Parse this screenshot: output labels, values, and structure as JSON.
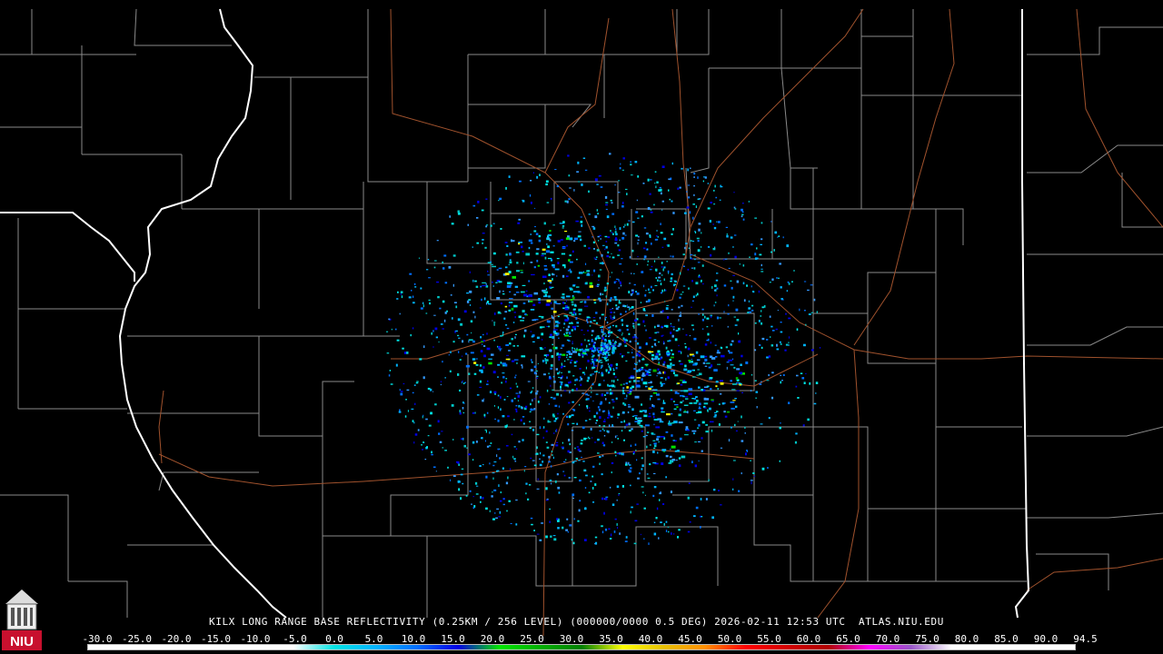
{
  "title": "KILX LONG RANGE BASE REFLECTIVITY (0.25KM / 256 LEVEL) (000000/0000 0.5 DEG) 2026-02-11 12:53 UTC  ATLAS.NIU.EDU",
  "logo": {
    "text": "NIU",
    "icon": "university-tower-icon"
  },
  "scale": {
    "labels": [
      "-30.0",
      "-25.0",
      "-20.0",
      "-15.0",
      "-10.0",
      "-5.0",
      "0.0",
      "5.0",
      "10.0",
      "15.0",
      "20.0",
      "25.0",
      "30.0",
      "35.0",
      "40.0",
      "45.0",
      "50.0",
      "55.0",
      "60.0",
      "65.0",
      "70.0",
      "75.0",
      "80.0",
      "85.0",
      "90.0",
      "94.5"
    ],
    "colors": [
      "#ffffff",
      "#ffffff",
      "#ffffff",
      "#ffffff",
      "#ffffff",
      "#ffffff",
      "#00e5e5",
      "#00b4ff",
      "#0070ff",
      "#0000e6",
      "#00e600",
      "#00b000",
      "#008000",
      "#ffff00",
      "#e6c000",
      "#ff9000",
      "#ff0000",
      "#d40000",
      "#b00000",
      "#ff00ff",
      "#9955c9",
      "#ffffff",
      "#ffffff",
      "#ffffff",
      "#ffffff"
    ]
  },
  "colors": {
    "background": "#000000",
    "county_lines": "#8a8a8a",
    "state_lines": "#ffffff",
    "highways": "#a0522d"
  }
}
